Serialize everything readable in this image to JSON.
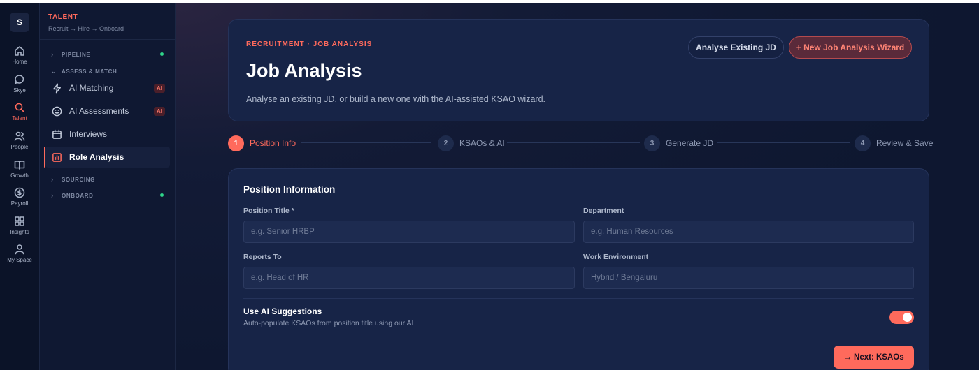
{
  "app": {
    "logo": "S"
  },
  "rail": {
    "items": [
      {
        "label": "Home",
        "icon": "home-icon"
      },
      {
        "label": "Skye",
        "icon": "chat-bubble-icon"
      },
      {
        "label": "Talent",
        "icon": "search-icon",
        "active": true
      },
      {
        "label": "People",
        "icon": "people-icon"
      },
      {
        "label": "Growth",
        "icon": "book-icon"
      },
      {
        "label": "Payroll",
        "icon": "dollar-icon"
      },
      {
        "label": "Insights",
        "icon": "grid-icon"
      },
      {
        "label": "My Space",
        "icon": "person-icon"
      }
    ]
  },
  "sidebar": {
    "title": "TALENT",
    "subtitle": "Recruit → Hire → Onboard",
    "groups": {
      "pipeline": "PIPELINE",
      "assess": "ASSESS & MATCH",
      "sourcing": "SOURCING",
      "onboard": "ONBOARD"
    },
    "items": [
      {
        "label": "AI Matching",
        "badge": "AI",
        "icon": "lightning-icon"
      },
      {
        "label": "AI Assessments",
        "badge": "AI",
        "icon": "smiley-icon"
      },
      {
        "label": "Interviews",
        "icon": "calendar-icon"
      },
      {
        "label": "Role Analysis",
        "icon": "bar-chart-icon",
        "active": true
      }
    ]
  },
  "hero": {
    "eyebrow": "RECRUITMENT · JOB ANALYSIS",
    "title": "Job Analysis",
    "description": "Analyse an existing JD, or build a new one with the AI-assisted KSAO wizard.",
    "btn_existing": "Analyse Existing JD",
    "btn_new": "+ New Job Analysis Wizard"
  },
  "stepper": [
    {
      "num": "1",
      "label": "Position Info",
      "active": true
    },
    {
      "num": "2",
      "label": "KSAOs & AI"
    },
    {
      "num": "3",
      "label": "Generate JD"
    },
    {
      "num": "4",
      "label": "Review & Save"
    }
  ],
  "form": {
    "title": "Position Information",
    "fields": {
      "position_title": {
        "label": "Position Title *",
        "placeholder": "e.g. Senior HRBP",
        "value": ""
      },
      "department": {
        "label": "Department",
        "placeholder": "e.g. Human Resources",
        "value": ""
      },
      "reports_to": {
        "label": "Reports To",
        "placeholder": "e.g. Head of HR",
        "value": ""
      },
      "work_env": {
        "label": "Work Environment",
        "placeholder": "Hybrid / Bengaluru",
        "value": ""
      }
    },
    "ai": {
      "title": "Use AI Suggestions",
      "subtitle": "Auto-populate KSAOs from position title using our AI",
      "enabled": true
    },
    "next_label": "→ Next: KSAOs"
  },
  "colors": {
    "accent": "#ff6a5c",
    "success": "#2fd58a",
    "bg": "#0e1730",
    "card": "#172447"
  }
}
